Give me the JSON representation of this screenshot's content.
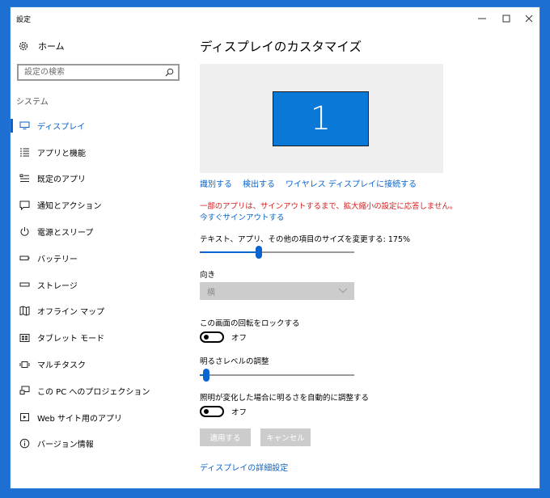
{
  "window": {
    "title": "設定",
    "controls": {
      "minimize": "minimize-icon",
      "maximize": "maximize-icon",
      "close": "close-icon"
    }
  },
  "sidebar": {
    "home_label": "ホーム",
    "search_placeholder": "設定の検索",
    "section_label": "システム",
    "items": [
      {
        "label": "ディスプレイ",
        "icon": "monitor-icon",
        "active": true
      },
      {
        "label": "アプリと機能",
        "icon": "list-icon"
      },
      {
        "label": "既定のアプリ",
        "icon": "default-apps-icon"
      },
      {
        "label": "通知とアクション",
        "icon": "notification-icon"
      },
      {
        "label": "電源とスリープ",
        "icon": "power-icon"
      },
      {
        "label": "バッテリー",
        "icon": "battery-icon"
      },
      {
        "label": "ストレージ",
        "icon": "storage-icon"
      },
      {
        "label": "オフライン マップ",
        "icon": "map-icon"
      },
      {
        "label": "タブレット モード",
        "icon": "tablet-icon"
      },
      {
        "label": "マルチタスク",
        "icon": "multitask-icon"
      },
      {
        "label": "この PC へのプロジェクション",
        "icon": "projection-icon"
      },
      {
        "label": "Web サイト用のアプリ",
        "icon": "web-apps-icon"
      },
      {
        "label": "バージョン情報",
        "icon": "info-icon"
      }
    ]
  },
  "main": {
    "title": "ディスプレイのカスタマイズ",
    "monitor_number": "1",
    "links": {
      "identify": "識別する",
      "detect": "検出する",
      "wireless": "ワイヤレス ディスプレイに接続する"
    },
    "warning": "一部のアプリは、サインアウトするまで、拡大縮小の設定に応答しません。",
    "signin_link": "今すぐサインアウトする",
    "scale_label": "テキスト、アプリ、その他の項目のサイズを変更する: 175%",
    "scale_fraction": 0.375,
    "orientation_label": "向き",
    "orientation_value": "横",
    "rotation_lock_label": "この画面の回転をロックする",
    "rotation_lock_state": "オフ",
    "brightness_label": "明るさレベルの調整",
    "brightness_fraction": 0.02,
    "auto_brightness_label": "照明が変化した場合に明るさを自動的に調整する",
    "auto_brightness_state": "オフ",
    "apply_button": "適用する",
    "cancel_button": "キャンセル",
    "advanced_link": "ディスプレイの詳細設定"
  },
  "colors": {
    "accent": "#0a64d0",
    "warning": "#d61d1d",
    "monitor": "#0a78d7",
    "desktop": "#1d6fd1"
  }
}
